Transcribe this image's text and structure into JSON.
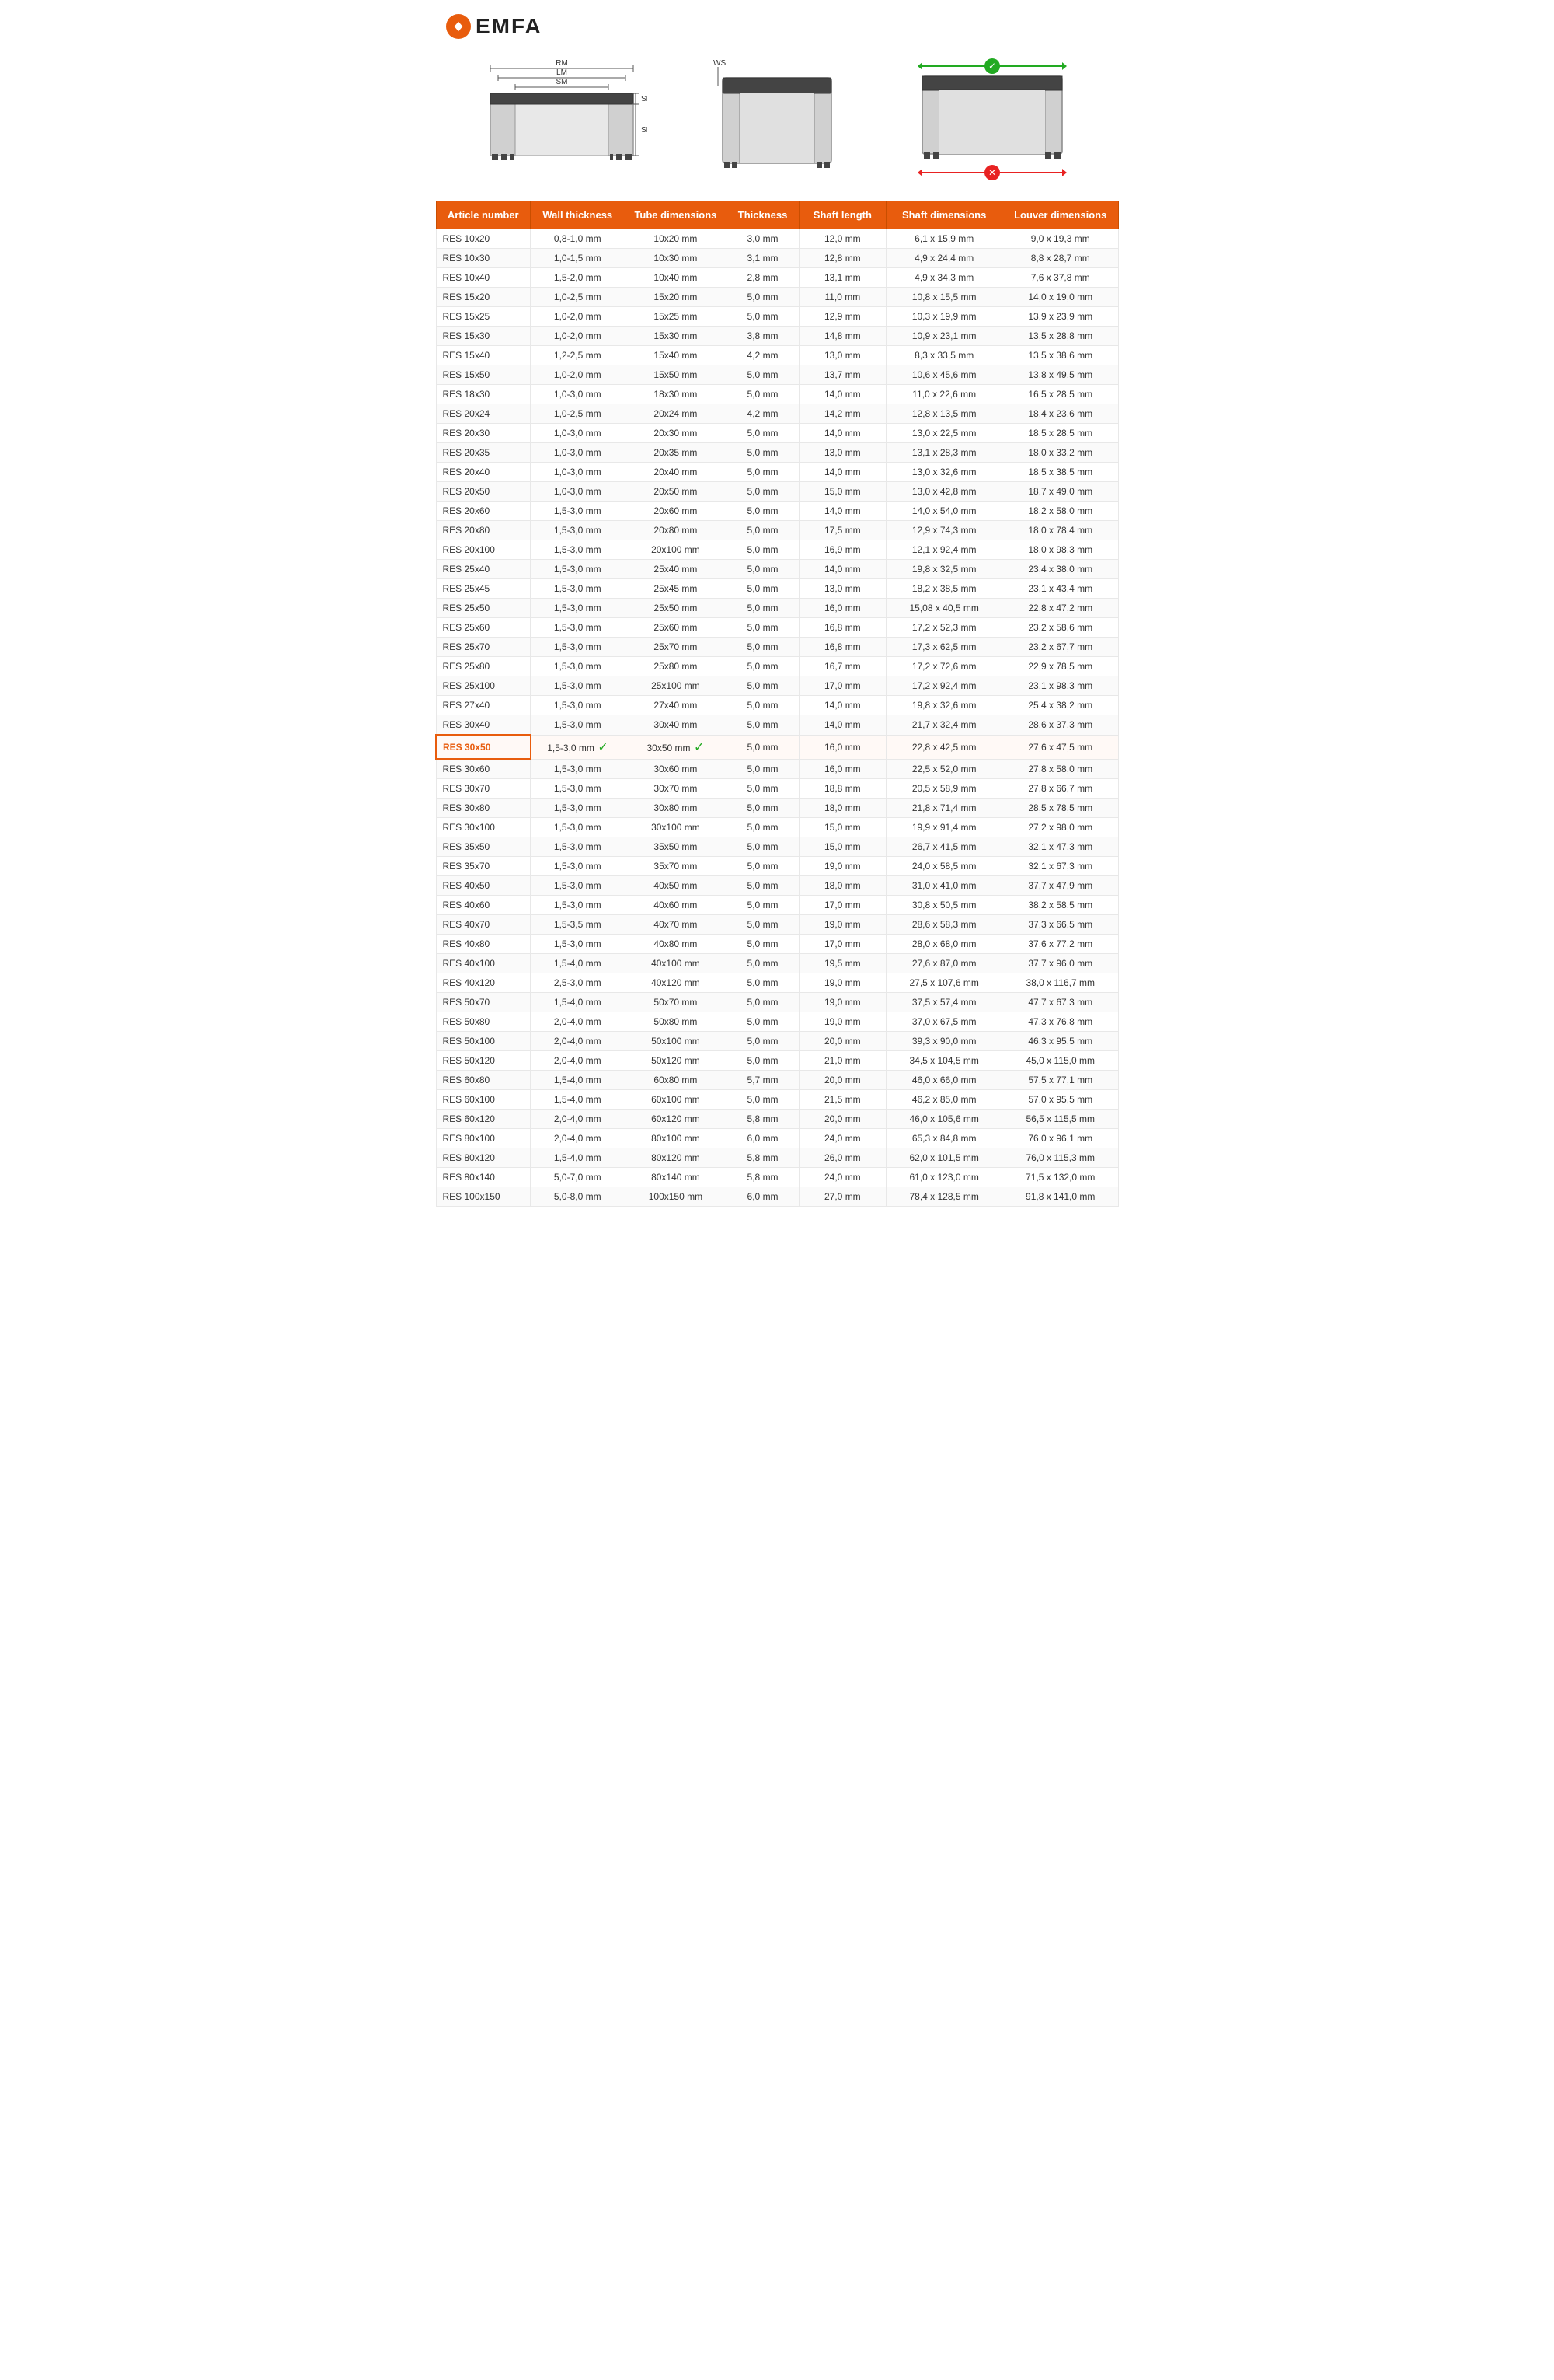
{
  "logo": {
    "brand": "EMFA"
  },
  "diagrams": {
    "labels": {
      "rm": "RM",
      "lm": "LM",
      "sm": "SM",
      "sk": "SK",
      "se": "SE",
      "ws": "WS"
    }
  },
  "table": {
    "headers": [
      "Article number",
      "Wall thickness",
      "Tube dimensions",
      "Thickness",
      "Shaft length",
      "Shaft dimensions",
      "Louver dimensions"
    ],
    "rows": [
      [
        "RES 10x20",
        "0,8-1,0 mm",
        "10x20 mm",
        "3,0 mm",
        "12,0 mm",
        "6,1 x 15,9 mm",
        "9,0 x 19,3 mm"
      ],
      [
        "RES 10x30",
        "1,0-1,5 mm",
        "10x30 mm",
        "3,1 mm",
        "12,8 mm",
        "4,9 x 24,4 mm",
        "8,8 x 28,7 mm"
      ],
      [
        "RES 10x40",
        "1,5-2,0 mm",
        "10x40 mm",
        "2,8 mm",
        "13,1 mm",
        "4,9 x 34,3 mm",
        "7,6 x 37,8 mm"
      ],
      [
        "RES 15x20",
        "1,0-2,5 mm",
        "15x20 mm",
        "5,0 mm",
        "11,0 mm",
        "10,8 x 15,5 mm",
        "14,0 x 19,0 mm"
      ],
      [
        "RES 15x25",
        "1,0-2,0 mm",
        "15x25 mm",
        "5,0 mm",
        "12,9 mm",
        "10,3 x 19,9 mm",
        "13,9 x 23,9 mm"
      ],
      [
        "RES 15x30",
        "1,0-2,0 mm",
        "15x30 mm",
        "3,8 mm",
        "14,8 mm",
        "10,9 x 23,1 mm",
        "13,5 x 28,8 mm"
      ],
      [
        "RES 15x40",
        "1,2-2,5 mm",
        "15x40 mm",
        "4,2 mm",
        "13,0 mm",
        "8,3 x 33,5 mm",
        "13,5 x 38,6 mm"
      ],
      [
        "RES 15x50",
        "1,0-2,0 mm",
        "15x50 mm",
        "5,0 mm",
        "13,7 mm",
        "10,6 x 45,6 mm",
        "13,8 x 49,5 mm"
      ],
      [
        "RES 18x30",
        "1,0-3,0 mm",
        "18x30 mm",
        "5,0 mm",
        "14,0 mm",
        "11,0 x 22,6 mm",
        "16,5 x 28,5 mm"
      ],
      [
        "RES 20x24",
        "1,0-2,5 mm",
        "20x24 mm",
        "4,2 mm",
        "14,2 mm",
        "12,8 x 13,5 mm",
        "18,4 x 23,6 mm"
      ],
      [
        "RES 20x30",
        "1,0-3,0 mm",
        "20x30 mm",
        "5,0 mm",
        "14,0 mm",
        "13,0 x 22,5 mm",
        "18,5 x 28,5 mm"
      ],
      [
        "RES 20x35",
        "1,0-3,0 mm",
        "20x35 mm",
        "5,0 mm",
        "13,0 mm",
        "13,1 x 28,3 mm",
        "18,0 x 33,2 mm"
      ],
      [
        "RES 20x40",
        "1,0-3,0 mm",
        "20x40 mm",
        "5,0 mm",
        "14,0 mm",
        "13,0 x 32,6 mm",
        "18,5 x 38,5 mm"
      ],
      [
        "RES 20x50",
        "1,0-3,0 mm",
        "20x50 mm",
        "5,0 mm",
        "15,0 mm",
        "13,0 x 42,8 mm",
        "18,7 x 49,0 mm"
      ],
      [
        "RES 20x60",
        "1,5-3,0 mm",
        "20x60 mm",
        "5,0 mm",
        "14,0 mm",
        "14,0 x 54,0 mm",
        "18,2 x 58,0 mm"
      ],
      [
        "RES 20x80",
        "1,5-3,0 mm",
        "20x80 mm",
        "5,0 mm",
        "17,5 mm",
        "12,9 x 74,3 mm",
        "18,0 x 78,4 mm"
      ],
      [
        "RES 20x100",
        "1,5-3,0 mm",
        "20x100 mm",
        "5,0 mm",
        "16,9 mm",
        "12,1 x 92,4 mm",
        "18,0 x 98,3 mm"
      ],
      [
        "RES 25x40",
        "1,5-3,0 mm",
        "25x40 mm",
        "5,0 mm",
        "14,0 mm",
        "19,8 x 32,5 mm",
        "23,4 x 38,0 mm"
      ],
      [
        "RES 25x45",
        "1,5-3,0 mm",
        "25x45 mm",
        "5,0 mm",
        "13,0 mm",
        "18,2 x 38,5 mm",
        "23,1 x 43,4 mm"
      ],
      [
        "RES 25x50",
        "1,5-3,0 mm",
        "25x50 mm",
        "5,0 mm",
        "16,0 mm",
        "15,08 x 40,5 mm",
        "22,8 x 47,2 mm"
      ],
      [
        "RES 25x60",
        "1,5-3,0 mm",
        "25x60 mm",
        "5,0 mm",
        "16,8 mm",
        "17,2 x 52,3 mm",
        "23,2 x 58,6 mm"
      ],
      [
        "RES 25x70",
        "1,5-3,0 mm",
        "25x70 mm",
        "5,0 mm",
        "16,8 mm",
        "17,3 x 62,5 mm",
        "23,2 x 67,7 mm"
      ],
      [
        "RES 25x80",
        "1,5-3,0 mm",
        "25x80 mm",
        "5,0 mm",
        "16,7 mm",
        "17,2 x 72,6 mm",
        "22,9 x 78,5 mm"
      ],
      [
        "RES 25x100",
        "1,5-3,0 mm",
        "25x100 mm",
        "5,0 mm",
        "17,0 mm",
        "17,2 x 92,4 mm",
        "23,1 x 98,3 mm"
      ],
      [
        "RES 27x40",
        "1,5-3,0 mm",
        "27x40 mm",
        "5,0 mm",
        "14,0 mm",
        "19,8 x 32,6 mm",
        "25,4 x 38,2 mm"
      ],
      [
        "RES 30x40",
        "1,5-3,0 mm",
        "30x40 mm",
        "5,0 mm",
        "14,0 mm",
        "21,7 x 32,4 mm",
        "28,6 x 37,3 mm"
      ],
      [
        "RES 30x50",
        "1,5-3,0 mm",
        "30x50 mm",
        "5,0 mm",
        "16,0 mm",
        "22,8 x 42,5 mm",
        "27,6 x 47,5 mm",
        "highlighted"
      ],
      [
        "RES 30x60",
        "1,5-3,0 mm",
        "30x60 mm",
        "5,0 mm",
        "16,0 mm",
        "22,5 x 52,0 mm",
        "27,8 x 58,0 mm"
      ],
      [
        "RES 30x70",
        "1,5-3,0 mm",
        "30x70 mm",
        "5,0 mm",
        "18,8 mm",
        "20,5 x 58,9 mm",
        "27,8 x 66,7 mm"
      ],
      [
        "RES 30x80",
        "1,5-3,0 mm",
        "30x80 mm",
        "5,0 mm",
        "18,0 mm",
        "21,8 x 71,4 mm",
        "28,5 x 78,5 mm"
      ],
      [
        "RES 30x100",
        "1,5-3,0 mm",
        "30x100 mm",
        "5,0 mm",
        "15,0 mm",
        "19,9 x 91,4 mm",
        "27,2 x 98,0 mm"
      ],
      [
        "RES 35x50",
        "1,5-3,0 mm",
        "35x50 mm",
        "5,0 mm",
        "15,0 mm",
        "26,7 x 41,5 mm",
        "32,1 x 47,3 mm"
      ],
      [
        "RES 35x70",
        "1,5-3,0 mm",
        "35x70 mm",
        "5,0 mm",
        "19,0 mm",
        "24,0 x 58,5 mm",
        "32,1 x 67,3 mm"
      ],
      [
        "RES 40x50",
        "1,5-3,0 mm",
        "40x50 mm",
        "5,0 mm",
        "18,0 mm",
        "31,0 x 41,0 mm",
        "37,7 x 47,9 mm"
      ],
      [
        "RES 40x60",
        "1,5-3,0 mm",
        "40x60 mm",
        "5,0 mm",
        "17,0 mm",
        "30,8 x 50,5 mm",
        "38,2 x 58,5 mm"
      ],
      [
        "RES 40x70",
        "1,5-3,5 mm",
        "40x70 mm",
        "5,0 mm",
        "19,0 mm",
        "28,6 x 58,3 mm",
        "37,3 x 66,5 mm"
      ],
      [
        "RES 40x80",
        "1,5-3,0 mm",
        "40x80 mm",
        "5,0 mm",
        "17,0 mm",
        "28,0 x 68,0 mm",
        "37,6 x 77,2 mm"
      ],
      [
        "RES 40x100",
        "1,5-4,0 mm",
        "40x100 mm",
        "5,0 mm",
        "19,5 mm",
        "27,6 x 87,0 mm",
        "37,7 x 96,0 mm"
      ],
      [
        "RES 40x120",
        "2,5-3,0 mm",
        "40x120 mm",
        "5,0 mm",
        "19,0 mm",
        "27,5 x 107,6 mm",
        "38,0 x 116,7 mm"
      ],
      [
        "RES 50x70",
        "1,5-4,0 mm",
        "50x70 mm",
        "5,0 mm",
        "19,0 mm",
        "37,5 x 57,4 mm",
        "47,7 x 67,3 mm"
      ],
      [
        "RES 50x80",
        "2,0-4,0 mm",
        "50x80 mm",
        "5,0 mm",
        "19,0 mm",
        "37,0 x 67,5 mm",
        "47,3 x 76,8 mm"
      ],
      [
        "RES 50x100",
        "2,0-4,0 mm",
        "50x100 mm",
        "5,0 mm",
        "20,0 mm",
        "39,3 x 90,0 mm",
        "46,3 x 95,5 mm"
      ],
      [
        "RES 50x120",
        "2,0-4,0 mm",
        "50x120 mm",
        "5,0 mm",
        "21,0 mm",
        "34,5 x 104,5 mm",
        "45,0 x 115,0 mm"
      ],
      [
        "RES 60x80",
        "1,5-4,0 mm",
        "60x80 mm",
        "5,7 mm",
        "20,0 mm",
        "46,0 x 66,0 mm",
        "57,5 x 77,1 mm"
      ],
      [
        "RES 60x100",
        "1,5-4,0 mm",
        "60x100 mm",
        "5,0 mm",
        "21,5 mm",
        "46,2 x 85,0 mm",
        "57,0 x 95,5 mm"
      ],
      [
        "RES 60x120",
        "2,0-4,0 mm",
        "60x120 mm",
        "5,8 mm",
        "20,0 mm",
        "46,0 x 105,6 mm",
        "56,5 x 115,5 mm"
      ],
      [
        "RES 80x100",
        "2,0-4,0 mm",
        "80x100 mm",
        "6,0 mm",
        "24,0 mm",
        "65,3 x 84,8 mm",
        "76,0 x 96,1 mm"
      ],
      [
        "RES 80x120",
        "1,5-4,0 mm",
        "80x120 mm",
        "5,8 mm",
        "26,0 mm",
        "62,0 x 101,5 mm",
        "76,0 x 115,3 mm"
      ],
      [
        "RES 80x140",
        "5,0-7,0 mm",
        "80x140 mm",
        "5,8 mm",
        "24,0 mm",
        "61,0 x 123,0 mm",
        "71,5 x 132,0 mm"
      ],
      [
        "RES 100x150",
        "5,0-8,0 mm",
        "100x150 mm",
        "6,0 mm",
        "27,0 mm",
        "78,4 x 128,5 mm",
        "91,8 x 141,0 mm"
      ]
    ]
  }
}
